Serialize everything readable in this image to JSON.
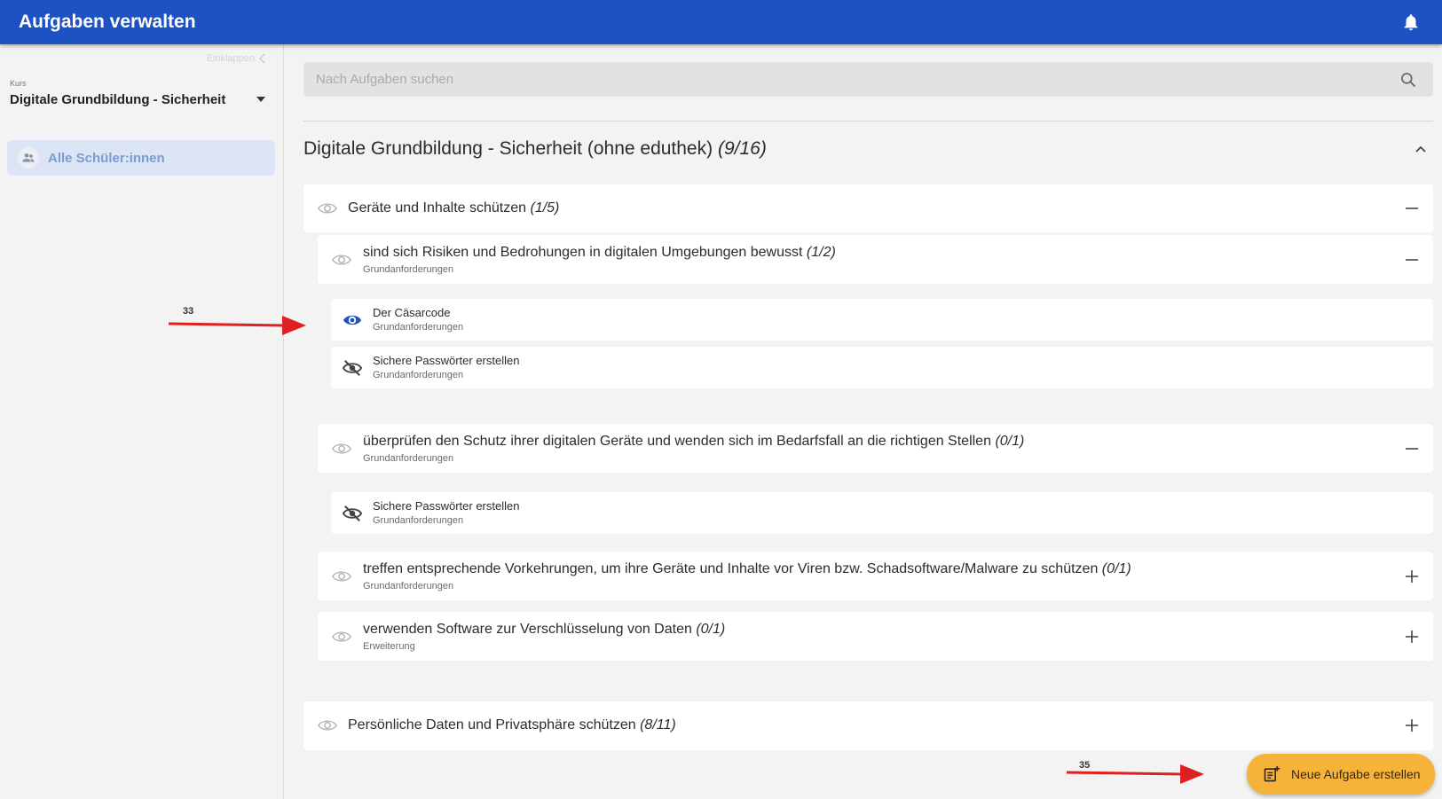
{
  "header": {
    "title": "Aufgaben verwalten",
    "bell_icon": "bell-icon"
  },
  "sidebar": {
    "collapse_label": "Einklappen",
    "kurs_label": "Kurs",
    "kurs_value": "Digitale Grundbildung - Sicherheit",
    "students_label": "Alle Schüler:innen"
  },
  "search": {
    "placeholder": "Nach Aufgaben suchen"
  },
  "section": {
    "title": "Digitale Grundbildung - Sicherheit (ohne eduthek)",
    "count": "(9/16)"
  },
  "groups": [
    {
      "title": "Geräte und Inhalte schützen",
      "count": "(1/5)"
    },
    {
      "title": "Persönliche Daten und Privatsphäre schützen",
      "count": "(8/11)"
    }
  ],
  "competencies": [
    {
      "title": "sind sich Risiken und Bedrohungen in digitalen Umgebungen bewusst",
      "count": "(1/2)",
      "level": "Grundanforderungen"
    },
    {
      "title": "überprüfen den Schutz ihrer digitalen Geräte und wenden sich im Bedarfsfall an die richtigen Stellen",
      "count": "(0/1)",
      "level": "Grundanforderungen"
    },
    {
      "title": "treffen entsprechende Vorkehrungen, um ihre Geräte und Inhalte vor Viren bzw. Schadsoftware/Malware zu schützen",
      "count": "(0/1)",
      "level": "Grundanforderungen"
    },
    {
      "title": "verwenden Software zur Verschlüsselung von Daten",
      "count": "(0/1)",
      "level": "Erweiterung"
    }
  ],
  "tasks": [
    {
      "title": "Der Cäsarcode",
      "level": "Grundanforderungen",
      "visible": true
    },
    {
      "title": "Sichere Passwörter erstellen",
      "level": "Grundanforderungen",
      "visible": false
    },
    {
      "title": "Sichere Passwörter erstellen",
      "level": "Grundanforderungen",
      "visible": false
    }
  ],
  "annotations": [
    {
      "label": "33"
    },
    {
      "label": "35"
    }
  ],
  "fab": {
    "label": "Neue Aufgabe erstellen"
  },
  "colors": {
    "header": "#1d52c5",
    "accent_eye": "#1d52c5",
    "fab": "#f6b33a",
    "annotation_arrow": "#e02020"
  }
}
